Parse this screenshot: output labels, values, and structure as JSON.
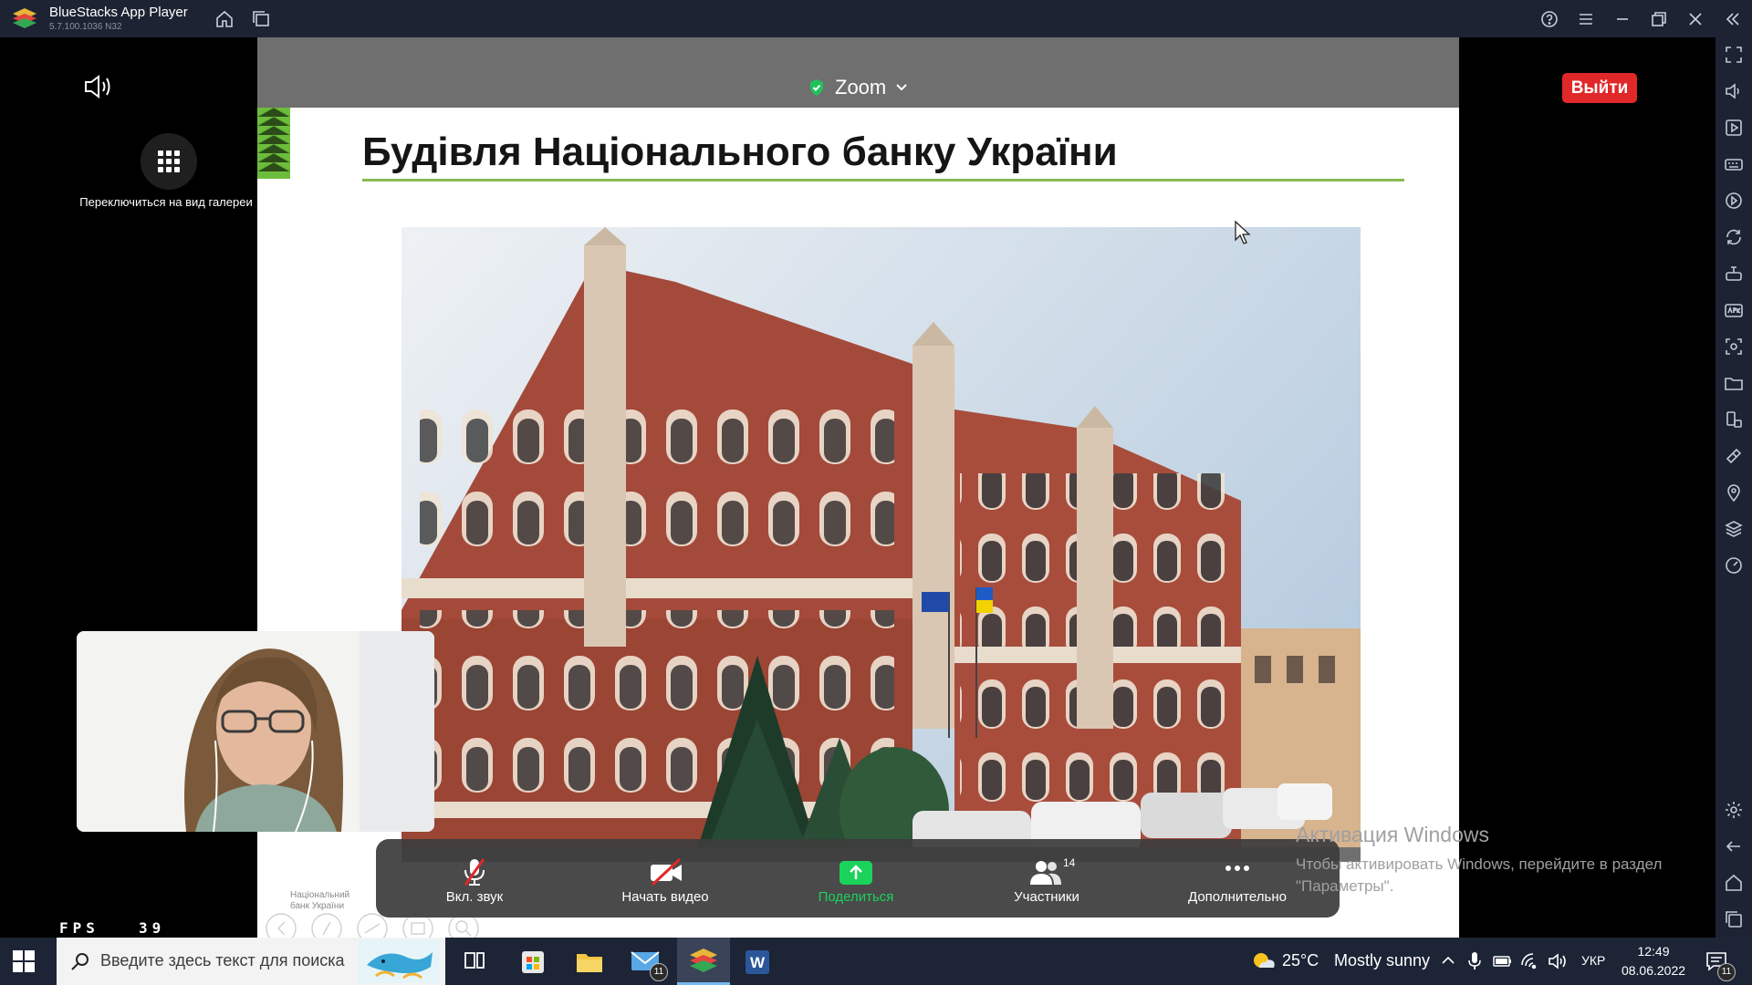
{
  "window": {
    "title": "BlueStacks App Player",
    "version": "5.7.100.1036  N32"
  },
  "zoom": {
    "title": "Zoom",
    "exit_label": "Выйти",
    "gallery_label": "Переключиться на вид галереи",
    "controls": {
      "mute_label": "Вкл. звук",
      "video_label": "Начать видео",
      "share_label": "Поделиться",
      "participants_label": "Участники",
      "participants_count": "14",
      "more_label": "Дополнительно"
    }
  },
  "slide": {
    "title": "Будівля Національного банку України",
    "logo_line1": "Національний",
    "logo_line2": "банк України"
  },
  "watermark": {
    "title": "Активация Windows",
    "text": "Чтобы активировать Windows, перейдите в раздел \"Параметры\"."
  },
  "fps": {
    "label": "FPS",
    "value": "39"
  },
  "taskbar": {
    "search_placeholder": "Введите здесь текст для поиска",
    "mail_badge": "11",
    "weather_temp": "25°C",
    "weather_text": "Mostly sunny",
    "language": "УКР",
    "time": "12:49",
    "date": "08.06.2022",
    "notifications_badge": "11"
  },
  "colors": {
    "accent_red": "#e02828",
    "share_green": "#1bd35b",
    "slide_green": "#6dbd3d",
    "titlebar": "#1d2333",
    "taskbar": "#1c2436"
  }
}
